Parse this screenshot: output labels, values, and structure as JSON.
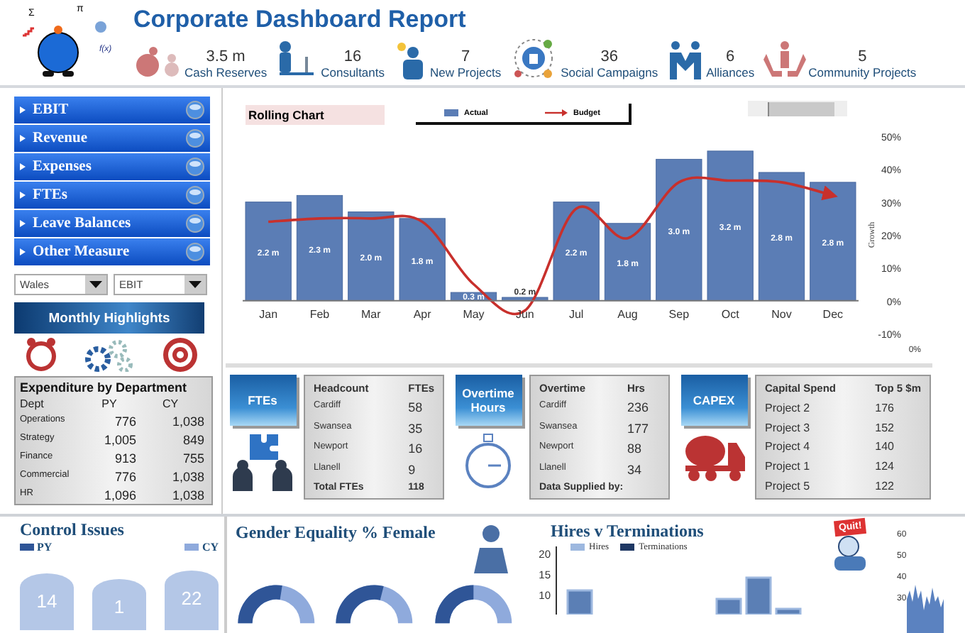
{
  "header": {
    "logo_symbols": [
      "Σ",
      "π",
      "f(x)"
    ],
    "title": "Corporate Dashboard Report",
    "kpis": [
      {
        "kind": "cash",
        "value": "3.5 m",
        "label": "Cash Reserves"
      },
      {
        "kind": "consultants",
        "value": "16",
        "label": "Consultants"
      },
      {
        "kind": "projects",
        "value": "7",
        "label": "New Projects"
      },
      {
        "kind": "social",
        "value": "36",
        "label": "Social Campaigns"
      },
      {
        "kind": "alliances",
        "value": "6",
        "label": "Alliances"
      },
      {
        "kind": "community",
        "value": "5",
        "label": "Community Projects"
      }
    ]
  },
  "menu": [
    {
      "label": "EBIT"
    },
    {
      "label": "Revenue"
    },
    {
      "label": "Expenses"
    },
    {
      "label": "FTEs"
    },
    {
      "label": "Leave Balances"
    },
    {
      "label": "Other Measure"
    }
  ],
  "filters": [
    {
      "value": "Wales"
    },
    {
      "value": "EBIT"
    }
  ],
  "highlights": {
    "title": "Monthly Highlights"
  },
  "expenditure": {
    "title": "Expenditure by Department",
    "columns": [
      "Dept",
      "PY",
      "CY"
    ],
    "rows": [
      [
        "Operations",
        "776",
        "1,038"
      ],
      [
        "Strategy",
        "1,005",
        "849"
      ],
      [
        "Finance",
        "913",
        "755"
      ],
      [
        "Commercial",
        "776",
        "1,038"
      ],
      [
        "HR",
        "1,096",
        "1,038"
      ]
    ]
  },
  "rolling_chart": {
    "title": "Rolling Chart",
    "footnote": "0%",
    "chart_data": {
      "type": "bar",
      "ylabel": "Growth",
      "categories": [
        "Jan",
        "Feb",
        "Mar",
        "Apr",
        "May",
        "Jun",
        "Jul",
        "Aug",
        "Sep",
        "Oct",
        "Nov",
        "Dec"
      ],
      "ylim": [
        -10,
        50
      ],
      "yticks": [
        {
          "value": -10,
          "label": "-10%"
        },
        {
          "value": 0,
          "label": "0%"
        },
        {
          "value": 10,
          "label": "10%"
        },
        {
          "value": 20,
          "label": "20%"
        },
        {
          "value": 30,
          "label": "30%"
        },
        {
          "value": 40,
          "label": "40%"
        },
        {
          "value": 50,
          "label": "50%"
        }
      ],
      "value_labels": [
        "2.2 m",
        "2.3 m",
        "2.0 m",
        "1.8 m",
        "0.3 m",
        "0.2 m",
        "2.2 m",
        "1.8 m",
        "3.0 m",
        "3.2 m",
        "2.8 m",
        "2.8 m"
      ],
      "series": [
        {
          "name": "Actual",
          "type": "bar",
          "color": "#5b7db5",
          "values": [
            30,
            32,
            27,
            25,
            2.5,
            1,
            30,
            23.5,
            43,
            45.5,
            39,
            36
          ]
        },
        {
          "name": "Budget",
          "type": "line",
          "color": "#c8302c",
          "values": [
            24,
            25,
            25,
            24,
            5,
            -3,
            28,
            19,
            36,
            36.5,
            36,
            32
          ]
        }
      ]
    }
  },
  "tiles": [
    {
      "kind": "fte",
      "title": "FTEs",
      "columns": [
        "Headcount",
        "FTEs"
      ],
      "rows": [
        [
          "Cardiff",
          "58"
        ],
        [
          "Swansea",
          "35"
        ],
        [
          "Newport",
          "16"
        ],
        [
          "Llanell",
          "9"
        ]
      ],
      "footer": [
        "Total FTEs",
        "118"
      ]
    },
    {
      "kind": "overtime",
      "title": "Overtime Hours",
      "columns": [
        "Overtime",
        "Hrs"
      ],
      "rows": [
        [
          "Cardiff",
          "236"
        ],
        [
          "Swansea",
          "177"
        ],
        [
          "Newport",
          "88"
        ],
        [
          "Llanell",
          "34"
        ]
      ],
      "footer": [
        "Data Supplied by:"
      ]
    },
    {
      "kind": "capex",
      "title": "CAPEX",
      "columns": [
        "Capital Spend",
        "Top 5 $m"
      ],
      "rows": [
        [
          "Project 2",
          "176"
        ],
        [
          "Project 3",
          "152"
        ],
        [
          "Project 4",
          "140"
        ],
        [
          "Project 1",
          "124"
        ],
        [
          "Project 5",
          "122"
        ]
      ]
    }
  ],
  "control_issues": {
    "title": "Control Issues",
    "legend": [
      {
        "label": "PY",
        "color": "#2f5597"
      },
      {
        "label": "CY",
        "color": "#8faadc"
      }
    ],
    "values": [
      "14",
      "1",
      "22"
    ]
  },
  "gender": {
    "title": "Gender Equality % Female",
    "donuts": [
      {
        "level": 0.55
      },
      {
        "level": 0.58
      },
      {
        "level": 0.5
      }
    ]
  },
  "hires": {
    "title": "Hires v Terminations",
    "sign": "Quit!",
    "legend": [
      {
        "label": "Hires",
        "color": "#9db8df"
      },
      {
        "label": "Terminations",
        "color": "#1f3864"
      }
    ],
    "axis_labels": [
      "20",
      "15",
      "10"
    ]
  },
  "side_chart": {
    "axis_labels": [
      "60",
      "50",
      "40",
      "30"
    ]
  }
}
